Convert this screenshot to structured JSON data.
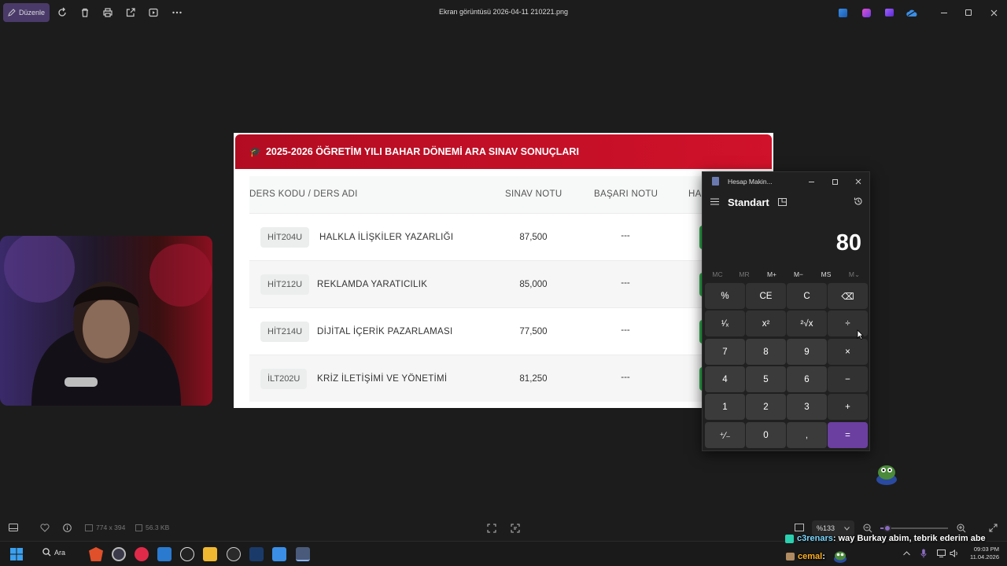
{
  "viewer": {
    "edit_label": "Düzenle",
    "file_title": "Ekran görüntüsü 2026-04-11 210221.png",
    "dimensions": "774 x 394",
    "file_size": "56.3 KB",
    "zoom": "%133",
    "zoom_level": 0.1
  },
  "results": {
    "header_icon": "🎓",
    "header_title": "2025-2026 ÖĞRETİM YILI BAHAR DÖNEMİ ARA SINAV SONUÇLARI",
    "col_course": "DERS KODU / DERS ADI",
    "col_exam": "SINAV NOTU",
    "col_success": "BAŞARI NOTU",
    "col_partial": "HA",
    "rows": [
      {
        "code": "HİT204U",
        "name": "HALKLA İLİŞKİLER YAZARLIĞI",
        "exam": "87,500",
        "success": "---"
      },
      {
        "code": "HİT212U",
        "name": "REKLAMDA YARATICILIK",
        "exam": "85,000",
        "success": "---"
      },
      {
        "code": "HİT214U",
        "name": "DİJİTAL İÇERİK PAZARLAMASI",
        "exam": "77,500",
        "success": "---"
      },
      {
        "code": "İLT202U",
        "name": "KRİZ İLETİŞİMİ VE YÖNETİMİ",
        "exam": "81,250",
        "success": "---"
      }
    ]
  },
  "calculator": {
    "title": "Hesap Makin...",
    "mode": "Standart",
    "display": "80",
    "memory": [
      "MC",
      "MR",
      "M+",
      "M−",
      "MS",
      "M⌄"
    ],
    "keys": [
      [
        "%",
        "CE",
        "C",
        "⌫"
      ],
      [
        "¹⁄ₓ",
        "x²",
        "²√x",
        "÷"
      ],
      [
        "7",
        "8",
        "9",
        "×"
      ],
      [
        "4",
        "5",
        "6",
        "−"
      ],
      [
        "1",
        "2",
        "3",
        "+"
      ],
      [
        "⁺⁄₋",
        "0",
        ",",
        "="
      ]
    ]
  },
  "taskbar": {
    "search_label": "Ara",
    "time": "09:03 PM",
    "date": "11.04.2026"
  },
  "chat": {
    "msg1_user": "c3renars",
    "msg1_text": ": way Burkay abim, tebrik ederim abe",
    "msg2_user": "cemal",
    "msg2_text": ":"
  },
  "colors": {
    "header_red": "#c8102e",
    "accent_purple": "#6b3fa0",
    "success_green": "#2bb34a"
  }
}
